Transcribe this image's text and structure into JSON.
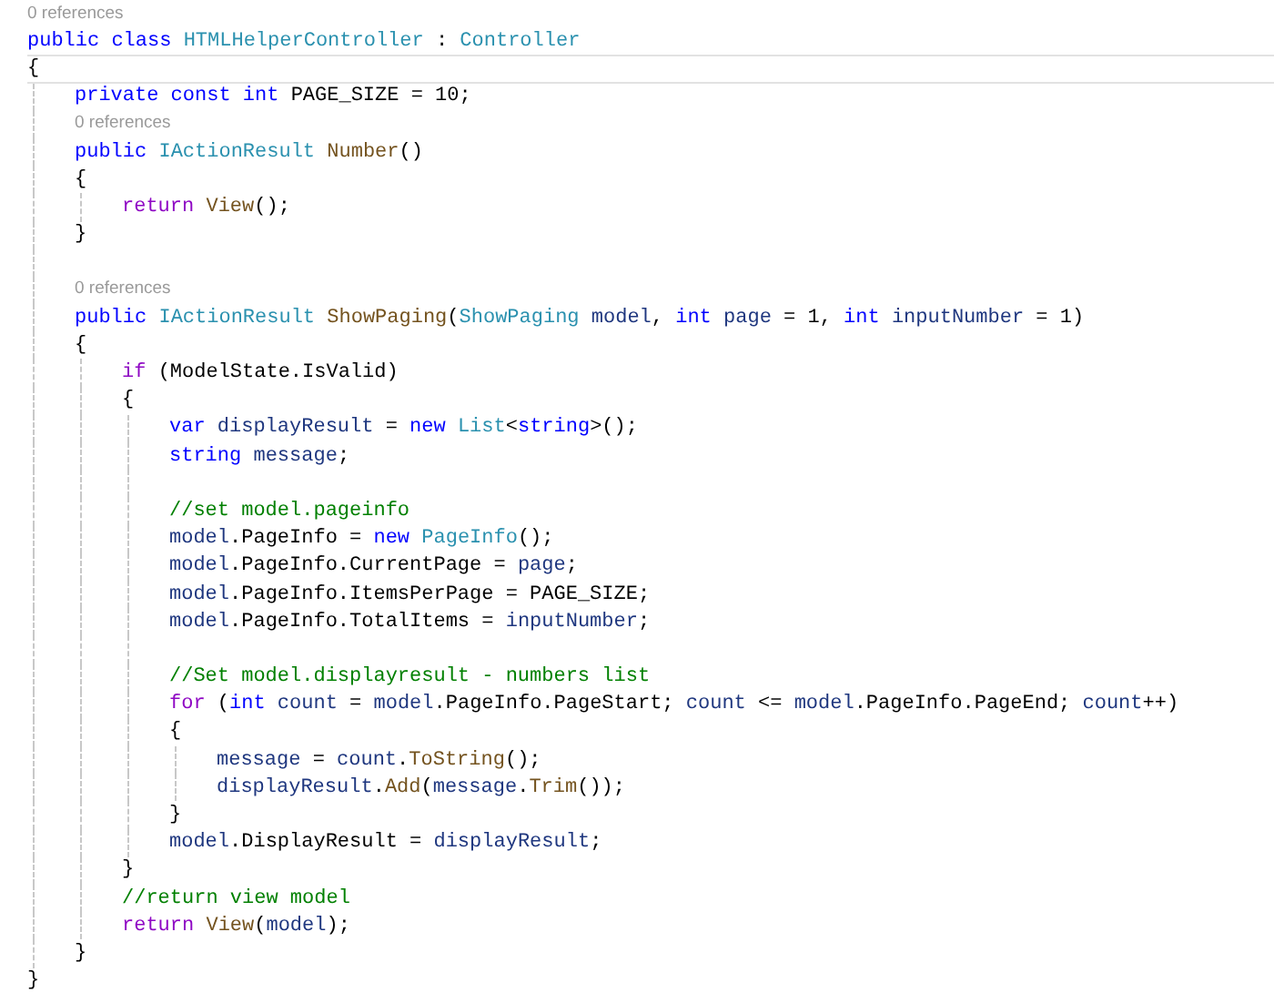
{
  "lines": [
    {
      "kind": "lens",
      "text": "0 references"
    },
    {
      "kind": "code",
      "current": false,
      "tokens": [
        {
          "kind": "keyword",
          "text": "public class "
        },
        {
          "kind": "type",
          "text": "HTMLHelperController"
        },
        {
          "kind": "plain",
          "text": " : "
        },
        {
          "kind": "type",
          "text": "Controller"
        }
      ]
    },
    {
      "kind": "code",
      "current": true,
      "tokens": [
        {
          "kind": "plain",
          "text": "{"
        }
      ],
      "children": [
        {
          "kind": "code",
          "current": false,
          "tokens": [
            {
              "kind": "keyword",
              "text": "private const int "
            },
            {
              "kind": "plain",
              "text": "PAGE_SIZE = 10;"
            }
          ]
        },
        {
          "kind": "lens",
          "text": "0 references"
        },
        {
          "kind": "code",
          "current": false,
          "tokens": [
            {
              "kind": "keyword",
              "text": "public "
            },
            {
              "kind": "type",
              "text": "IActionResult "
            },
            {
              "kind": "method",
              "text": "Number"
            },
            {
              "kind": "plain",
              "text": "()"
            }
          ]
        },
        {
          "kind": "code",
          "current": false,
          "tokens": [
            {
              "kind": "plain",
              "text": "{"
            }
          ],
          "children": [
            {
              "kind": "code",
              "current": false,
              "tokens": [
                {
                  "kind": "control",
                  "text": "return "
                },
                {
                  "kind": "method",
                  "text": "View"
                },
                {
                  "kind": "plain",
                  "text": "();"
                }
              ]
            }
          ]
        },
        {
          "kind": "code",
          "current": false,
          "tokens": [
            {
              "kind": "plain",
              "text": "}"
            }
          ]
        },
        {
          "kind": "blank"
        },
        {
          "kind": "lens",
          "text": "0 references"
        },
        {
          "kind": "code",
          "current": false,
          "tokens": [
            {
              "kind": "keyword",
              "text": "public "
            },
            {
              "kind": "type",
              "text": "IActionResult "
            },
            {
              "kind": "method",
              "text": "ShowPaging"
            },
            {
              "kind": "plain",
              "text": "("
            },
            {
              "kind": "type",
              "text": "ShowPaging "
            },
            {
              "kind": "local",
              "text": "model"
            },
            {
              "kind": "plain",
              "text": ", "
            },
            {
              "kind": "keyword",
              "text": "int "
            },
            {
              "kind": "local",
              "text": "page"
            },
            {
              "kind": "plain",
              "text": " = 1, "
            },
            {
              "kind": "keyword",
              "text": "int "
            },
            {
              "kind": "local",
              "text": "inputNumber"
            },
            {
              "kind": "plain",
              "text": " = 1)"
            }
          ]
        },
        {
          "kind": "code",
          "current": false,
          "tokens": [
            {
              "kind": "plain",
              "text": "{"
            }
          ],
          "children": [
            {
              "kind": "code",
              "current": false,
              "tokens": [
                {
                  "kind": "control",
                  "text": "if "
                },
                {
                  "kind": "plain",
                  "text": "(ModelState.IsValid)"
                }
              ]
            },
            {
              "kind": "code",
              "current": false,
              "tokens": [
                {
                  "kind": "plain",
                  "text": "{"
                }
              ],
              "children": [
                {
                  "kind": "code",
                  "current": false,
                  "tokens": [
                    {
                      "kind": "keyword",
                      "text": "var "
                    },
                    {
                      "kind": "local",
                      "text": "displayResult"
                    },
                    {
                      "kind": "plain",
                      "text": " = "
                    },
                    {
                      "kind": "keyword",
                      "text": "new "
                    },
                    {
                      "kind": "type",
                      "text": "List"
                    },
                    {
                      "kind": "plain",
                      "text": "<"
                    },
                    {
                      "kind": "keyword",
                      "text": "string"
                    },
                    {
                      "kind": "plain",
                      "text": ">();"
                    }
                  ]
                },
                {
                  "kind": "code",
                  "current": false,
                  "tokens": [
                    {
                      "kind": "keyword",
                      "text": "string "
                    },
                    {
                      "kind": "local",
                      "text": "message"
                    },
                    {
                      "kind": "plain",
                      "text": ";"
                    }
                  ]
                },
                {
                  "kind": "blank"
                },
                {
                  "kind": "code",
                  "current": false,
                  "tokens": [
                    {
                      "kind": "comment",
                      "text": "//set model.pageinfo"
                    }
                  ]
                },
                {
                  "kind": "code",
                  "current": false,
                  "tokens": [
                    {
                      "kind": "local",
                      "text": "model"
                    },
                    {
                      "kind": "plain",
                      "text": ".PageInfo = "
                    },
                    {
                      "kind": "keyword",
                      "text": "new "
                    },
                    {
                      "kind": "type",
                      "text": "PageInfo"
                    },
                    {
                      "kind": "plain",
                      "text": "();"
                    }
                  ]
                },
                {
                  "kind": "code",
                  "current": false,
                  "tokens": [
                    {
                      "kind": "local",
                      "text": "model"
                    },
                    {
                      "kind": "plain",
                      "text": ".PageInfo.CurrentPage = "
                    },
                    {
                      "kind": "local",
                      "text": "page"
                    },
                    {
                      "kind": "plain",
                      "text": ";"
                    }
                  ]
                },
                {
                  "kind": "code",
                  "current": false,
                  "tokens": [
                    {
                      "kind": "local",
                      "text": "model"
                    },
                    {
                      "kind": "plain",
                      "text": ".PageInfo.ItemsPerPage = PAGE_SIZE;"
                    }
                  ]
                },
                {
                  "kind": "code",
                  "current": false,
                  "tokens": [
                    {
                      "kind": "local",
                      "text": "model"
                    },
                    {
                      "kind": "plain",
                      "text": ".PageInfo.TotalItems = "
                    },
                    {
                      "kind": "local",
                      "text": "inputNumber"
                    },
                    {
                      "kind": "plain",
                      "text": ";"
                    }
                  ]
                },
                {
                  "kind": "blank"
                },
                {
                  "kind": "code",
                  "current": false,
                  "tokens": [
                    {
                      "kind": "comment",
                      "text": "//Set model.displayresult - numbers list"
                    }
                  ]
                },
                {
                  "kind": "code",
                  "current": false,
                  "tokens": [
                    {
                      "kind": "control",
                      "text": "for "
                    },
                    {
                      "kind": "plain",
                      "text": "("
                    },
                    {
                      "kind": "keyword",
                      "text": "int "
                    },
                    {
                      "kind": "local",
                      "text": "count"
                    },
                    {
                      "kind": "plain",
                      "text": " = "
                    },
                    {
                      "kind": "local",
                      "text": "model"
                    },
                    {
                      "kind": "plain",
                      "text": ".PageInfo.PageStart; "
                    },
                    {
                      "kind": "local",
                      "text": "count"
                    },
                    {
                      "kind": "plain",
                      "text": " <= "
                    },
                    {
                      "kind": "local",
                      "text": "model"
                    },
                    {
                      "kind": "plain",
                      "text": ".PageInfo.PageEnd; "
                    },
                    {
                      "kind": "local",
                      "text": "count"
                    },
                    {
                      "kind": "plain",
                      "text": "++)"
                    }
                  ]
                },
                {
                  "kind": "code",
                  "current": false,
                  "tokens": [
                    {
                      "kind": "plain",
                      "text": "{"
                    }
                  ],
                  "children": [
                    {
                      "kind": "code",
                      "current": false,
                      "tokens": [
                        {
                          "kind": "local",
                          "text": "message"
                        },
                        {
                          "kind": "plain",
                          "text": " = "
                        },
                        {
                          "kind": "local",
                          "text": "count"
                        },
                        {
                          "kind": "plain",
                          "text": "."
                        },
                        {
                          "kind": "method",
                          "text": "ToString"
                        },
                        {
                          "kind": "plain",
                          "text": "();"
                        }
                      ]
                    },
                    {
                      "kind": "code",
                      "current": false,
                      "tokens": [
                        {
                          "kind": "local",
                          "text": "displayResult"
                        },
                        {
                          "kind": "plain",
                          "text": "."
                        },
                        {
                          "kind": "method",
                          "text": "Add"
                        },
                        {
                          "kind": "plain",
                          "text": "("
                        },
                        {
                          "kind": "local",
                          "text": "message"
                        },
                        {
                          "kind": "plain",
                          "text": "."
                        },
                        {
                          "kind": "method",
                          "text": "Trim"
                        },
                        {
                          "kind": "plain",
                          "text": "());"
                        }
                      ]
                    }
                  ]
                },
                {
                  "kind": "code",
                  "current": false,
                  "tokens": [
                    {
                      "kind": "plain",
                      "text": "}"
                    }
                  ]
                },
                {
                  "kind": "code",
                  "current": false,
                  "tokens": [
                    {
                      "kind": "local",
                      "text": "model"
                    },
                    {
                      "kind": "plain",
                      "text": ".DisplayResult = "
                    },
                    {
                      "kind": "local",
                      "text": "displayResult"
                    },
                    {
                      "kind": "plain",
                      "text": ";"
                    }
                  ]
                }
              ]
            },
            {
              "kind": "code",
              "current": false,
              "tokens": [
                {
                  "kind": "plain",
                  "text": "}"
                }
              ]
            },
            {
              "kind": "code",
              "current": false,
              "tokens": [
                {
                  "kind": "comment",
                  "text": "//return view model"
                }
              ]
            },
            {
              "kind": "code",
              "current": false,
              "tokens": [
                {
                  "kind": "control",
                  "text": "return "
                },
                {
                  "kind": "method",
                  "text": "View"
                },
                {
                  "kind": "plain",
                  "text": "("
                },
                {
                  "kind": "local",
                  "text": "model"
                },
                {
                  "kind": "plain",
                  "text": ");"
                }
              ]
            }
          ]
        },
        {
          "kind": "code",
          "current": false,
          "tokens": [
            {
              "kind": "plain",
              "text": "}"
            }
          ]
        }
      ]
    },
    {
      "kind": "code",
      "current": false,
      "tokens": [
        {
          "kind": "plain",
          "text": "}"
        }
      ]
    }
  ]
}
